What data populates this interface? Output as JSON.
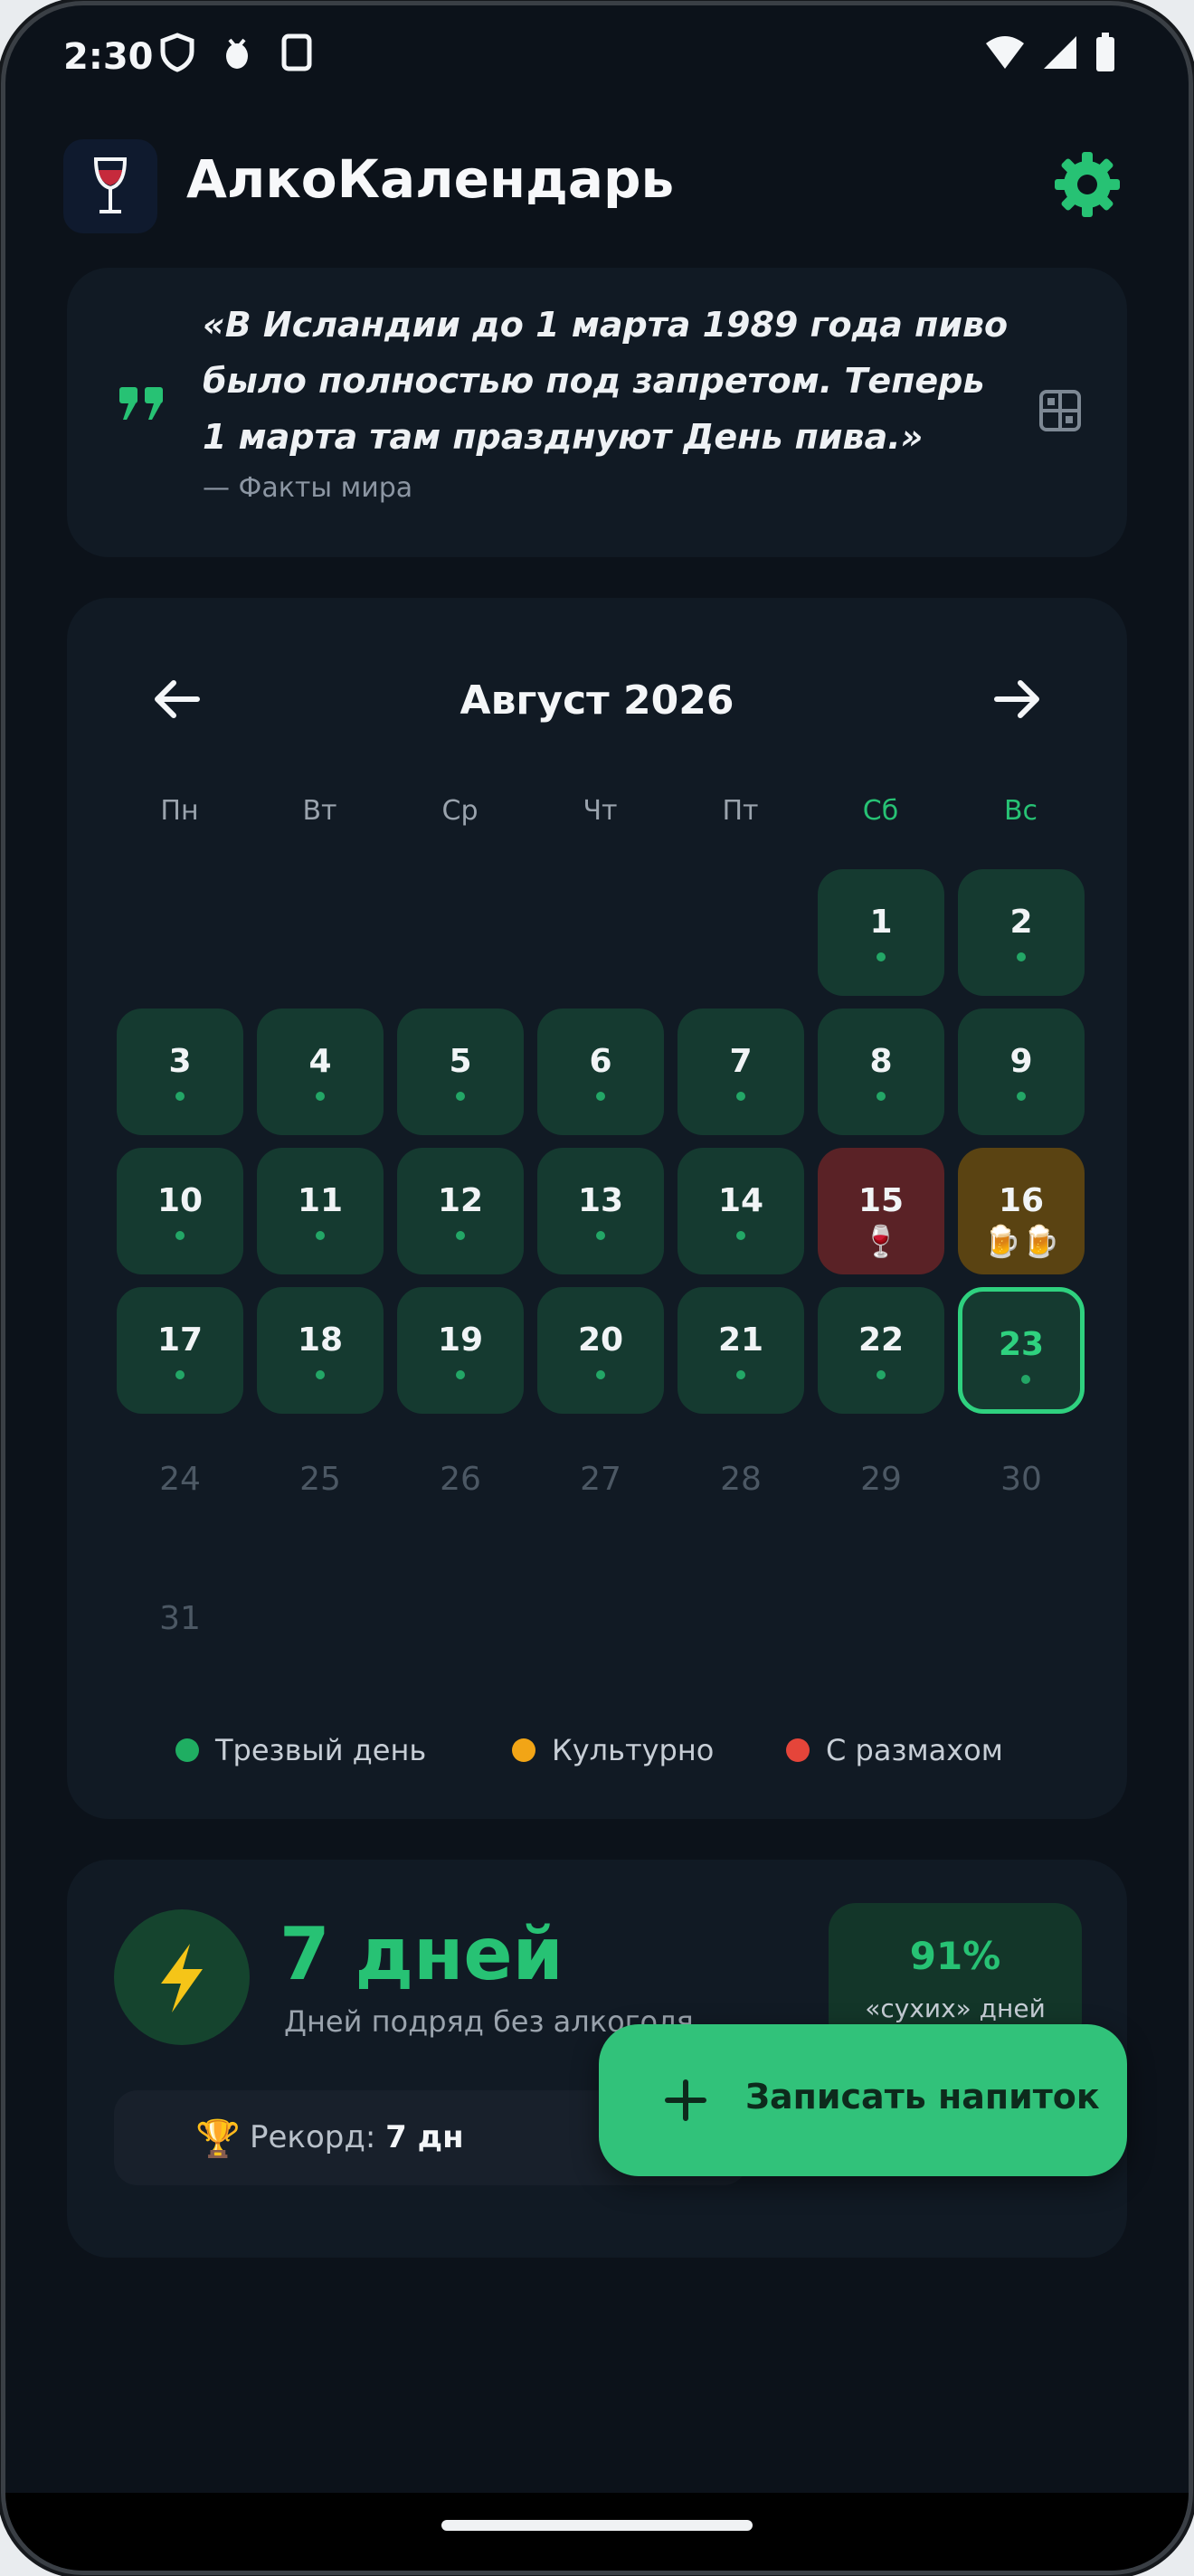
{
  "status_bar": {
    "time": "2:30"
  },
  "app": {
    "title": "АлкоКалендарь"
  },
  "quote": {
    "text": "«В Исландии до 1 марта 1989 года пиво было полностью под запретом. Теперь 1 марта там празднуют День пива.»",
    "source": "— Факты мира"
  },
  "calendar": {
    "month_title": "Август 2026",
    "weekdays": [
      "Пн",
      "Вт",
      "Ср",
      "Чт",
      "Пт",
      "Сб",
      "Вс"
    ],
    "days": [
      {
        "n": "1",
        "state": "sober"
      },
      {
        "n": "2",
        "state": "sober"
      },
      {
        "n": "3",
        "state": "sober"
      },
      {
        "n": "4",
        "state": "sober"
      },
      {
        "n": "5",
        "state": "sober"
      },
      {
        "n": "6",
        "state": "sober"
      },
      {
        "n": "7",
        "state": "sober"
      },
      {
        "n": "8",
        "state": "sober"
      },
      {
        "n": "9",
        "state": "sober"
      },
      {
        "n": "10",
        "state": "sober"
      },
      {
        "n": "11",
        "state": "sober"
      },
      {
        "n": "12",
        "state": "sober"
      },
      {
        "n": "13",
        "state": "sober"
      },
      {
        "n": "14",
        "state": "sober"
      },
      {
        "n": "15",
        "state": "heavy",
        "emoji": "🍷"
      },
      {
        "n": "16",
        "state": "cultural",
        "emoji": "🍺🍺"
      },
      {
        "n": "17",
        "state": "sober"
      },
      {
        "n": "18",
        "state": "sober"
      },
      {
        "n": "19",
        "state": "sober"
      },
      {
        "n": "20",
        "state": "sober"
      },
      {
        "n": "21",
        "state": "sober"
      },
      {
        "n": "22",
        "state": "sober"
      },
      {
        "n": "23",
        "state": "today"
      },
      {
        "n": "24",
        "state": "future"
      },
      {
        "n": "25",
        "state": "future"
      },
      {
        "n": "26",
        "state": "future"
      },
      {
        "n": "27",
        "state": "future"
      },
      {
        "n": "28",
        "state": "future"
      },
      {
        "n": "29",
        "state": "future"
      },
      {
        "n": "30",
        "state": "future"
      },
      {
        "n": "31",
        "state": "future"
      }
    ],
    "legend": [
      {
        "label": "Трезвый день",
        "color": "#1fae62"
      },
      {
        "label": "Культурно",
        "color": "#f2a516"
      },
      {
        "label": "С размахом",
        "color": "#e5453a"
      }
    ]
  },
  "stats": {
    "streak_value": "7 дней",
    "streak_label": "Дней подряд без алкоголя",
    "percent_value": "91%",
    "percent_label": "«сухих» дней",
    "record_label": "Рекорд:",
    "record_value": "7 дн"
  },
  "fab": {
    "label": "Записать напиток"
  },
  "colors": {
    "accent": "#31c27a",
    "background": "#0c121a",
    "card": "#111a24"
  }
}
